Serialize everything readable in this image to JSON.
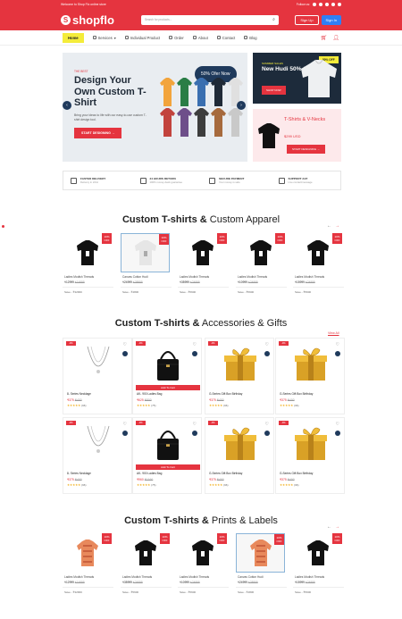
{
  "topbar": {
    "welcome": "Welcome to Shop Flo online store",
    "follow": "Follow us:"
  },
  "header": {
    "logo": "shopflo",
    "search_placeholder": "Search for products...",
    "signup": "Sign Up",
    "signin": "Sign In"
  },
  "nav": {
    "items": [
      "Home",
      "Services",
      "Individual Product",
      "Order",
      "About",
      "Contact",
      "Blog"
    ]
  },
  "hero": {
    "tag": "THE BEST",
    "title": "Design Your Own Custom T-Shirt",
    "desc": "Bring your ideas to life with our easy-to-use custom T-shirt design tool.",
    "cta": "START DESIGNING",
    "offer": "50% Ofer Now"
  },
  "promo1": {
    "label": "SUMMER SALES",
    "title": "New Hudi 50% Off",
    "badge": "50% OFF",
    "button": "SHOP NOW"
  },
  "promo2": {
    "title": "T-Shirts & V-Necks",
    "price": "$299 USD",
    "button": "START DESIGNING"
  },
  "features": [
    {
      "title": "FASTED DELIVERY",
      "sub": "Delivery in 24/H"
    },
    {
      "title": "24 HOURS RETURN",
      "sub": "100% money-back guarantee"
    },
    {
      "title": "SECURE PAYMENT",
      "sub": "Your money is safe"
    },
    {
      "title": "SUPPORT 24/7",
      "sub": "Live contact/message"
    }
  ],
  "section1": {
    "title_bold": "Custom T-shirts &",
    "title_rest": " Custom Apparel",
    "products": [
      {
        "name": "Ladies Modish Threads",
        "price": "₹12999",
        "old": "₹14999",
        "save": "Save - ₹32999",
        "discount": "10% OFF",
        "color": "black"
      },
      {
        "name": "Canvas Cotton Hudi",
        "price": "₹24999",
        "old": "₹38999",
        "save": "Save - ₹4806",
        "discount": "10% OFF",
        "color": "white"
      },
      {
        "name": "Ladies Modish Threads",
        "price": "₹35999",
        "old": "₹24999",
        "save": "Save - ₹5600",
        "discount": "10% OFF",
        "color": "black"
      },
      {
        "name": "Ladies Modish Threads",
        "price": "₹10999",
        "old": "₹24999",
        "save": "Save - ₹5600",
        "discount": "10% OFF",
        "color": "black"
      },
      {
        "name": "Ladies Modish Threads",
        "price": "₹15999",
        "old": "₹24999",
        "save": "Save - ₹5600",
        "discount": "10% OFF",
        "color": "black"
      }
    ]
  },
  "section2": {
    "title_bold": "Custom T-shirts &",
    "title_rest": " Accessories & Gifts",
    "view_all": "View All",
    "add_to_cart": "Add To Cart",
    "products": [
      {
        "name": "8- Series Necklage",
        "price": "₹375",
        "old": "₹400",
        "reviews": "(96)",
        "discount": "-0%",
        "kind": "necklace"
      },
      {
        "name": "AK- 900 Ladies Bag",
        "price": "₹625",
        "old": "₹800",
        "reviews": "(75)",
        "discount": "-0%",
        "kind": "bag"
      },
      {
        "name": "G-Series Gift Box Birthday",
        "price": "₹375",
        "old": "₹400",
        "reviews": "(96)",
        "discount": "-0%",
        "kind": "gift"
      },
      {
        "name": "G-Series Gift Box Birthday",
        "price": "₹375",
        "old": "₹400",
        "reviews": "(96)",
        "discount": "-0%",
        "kind": "gift"
      },
      {
        "name": "8- Series Necklage",
        "price": "₹375",
        "old": "₹400",
        "reviews": "(96)",
        "discount": "-0%",
        "kind": "necklace"
      },
      {
        "name": "AK- 900 Ladies Bag",
        "price": "₹960",
        "old": "₹1160",
        "reviews": "(75)",
        "discount": "-0%",
        "kind": "bag"
      },
      {
        "name": "G-Series Gift Box Birthday",
        "price": "₹375",
        "old": "₹400",
        "reviews": "(96)",
        "discount": "-0%",
        "kind": "gift"
      },
      {
        "name": "G-Series Gift Box Birthday",
        "price": "₹375",
        "old": "₹400",
        "reviews": "(96)",
        "discount": "-0%",
        "kind": "gift"
      }
    ]
  },
  "section3": {
    "title_bold": "Custom T-shirts &",
    "title_rest": " Prints & Labels",
    "products": [
      {
        "name": "Ladies Modish Threads",
        "price": "₹12999",
        "old": "₹14999",
        "save": "Save - ₹32999",
        "discount": "10% OFF",
        "color": "shirt"
      },
      {
        "name": "Ladies Modish Threads",
        "price": "₹35999",
        "old": "₹24999",
        "save": "Save - ₹5600",
        "discount": "10% OFF",
        "color": "black"
      },
      {
        "name": "Ladies Modish Threads",
        "price": "₹10999",
        "old": "₹24999",
        "save": "Save - ₹5600",
        "discount": "10% OFF",
        "color": "black"
      },
      {
        "name": "Canvas Cotton Hudi",
        "price": "₹24999",
        "old": "₹38999",
        "save": "Save - ₹4806",
        "discount": "10% OFF",
        "color": "shirt"
      },
      {
        "name": "Ladies Modish Threads",
        "price": "₹15999",
        "old": "₹24999",
        "save": "Save - ₹5600",
        "discount": "10% OFF",
        "color": "black"
      }
    ]
  },
  "colors": {
    "accent": "#e5343f",
    "navy": "#1f3a5c",
    "highlight": "#f4ec3a",
    "blue": "#2f7ff5"
  }
}
